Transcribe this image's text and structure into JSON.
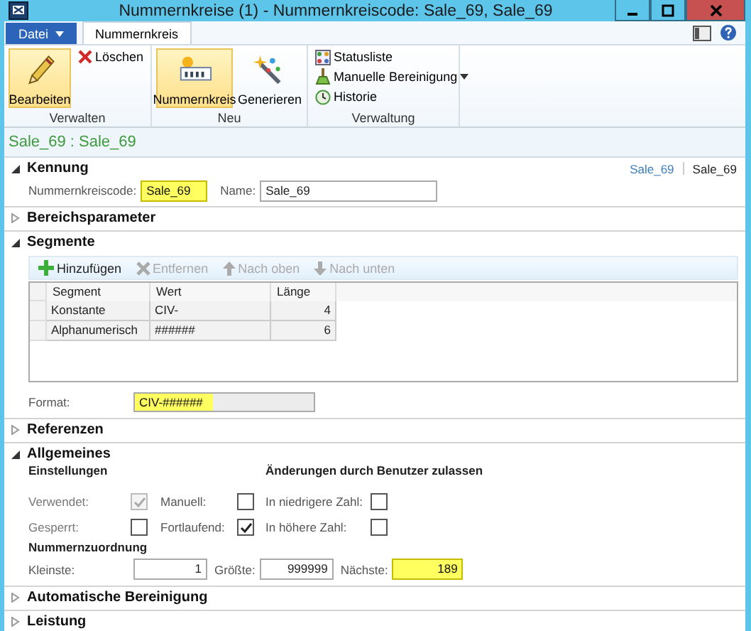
{
  "window": {
    "title": "Nummernkreise (1) - Nummernkreiscode: Sale_69, Sale_69"
  },
  "file_menu": {
    "label": "Datei"
  },
  "tabs": [
    {
      "label": "Nummernkreis",
      "selected": true
    }
  ],
  "ribbon": [
    {
      "label": "Verwalten",
      "buttons": [
        {
          "label": "Bearbeiten",
          "kind": "large",
          "active": true
        },
        {
          "label": "Löschen",
          "kind": "small",
          "active": false
        }
      ]
    },
    {
      "label": "Neu",
      "buttons": [
        {
          "label": "Nummernkreis",
          "kind": "large",
          "active": true
        },
        {
          "label": "Generieren",
          "kind": "large",
          "active": false
        }
      ]
    },
    {
      "label": "Verwaltung",
      "buttons": [
        {
          "label": "Statusliste",
          "kind": "small",
          "active": false
        },
        {
          "label": "Manuelle Bereinigung",
          "kind": "small",
          "active": false,
          "dropdown": true
        },
        {
          "label": "Historie",
          "kind": "small",
          "active": false
        }
      ]
    }
  ],
  "record_title": "Sale_69 : Sale_69",
  "breadcrumb": [
    {
      "label": "Sale_69",
      "kind": "link"
    },
    {
      "label": "Sale_69",
      "kind": "current"
    }
  ],
  "sections": [
    {
      "title": "Kennung",
      "kind": "identification",
      "expanded": true,
      "fields": [
        {
          "label": "Nummernkreiscode:",
          "value": "Sale_69",
          "highlighted": true
        },
        {
          "label": "Name:",
          "value": "Sale_69",
          "highlighted": false
        }
      ]
    },
    {
      "title": "Bereichsparameter",
      "expanded": false
    },
    {
      "title": "Segmente",
      "kind": "segments",
      "expanded": true,
      "toolbar": [
        {
          "label": "Hinzufügen",
          "disabled": false
        },
        {
          "label": "Entfernen",
          "disabled": true
        },
        {
          "label": "Nach oben",
          "disabled": true
        },
        {
          "label": "Nach unten",
          "disabled": true
        }
      ],
      "table": {
        "columns": [
          "Segment",
          "Wert",
          "Länge"
        ],
        "rows": [
          [
            "Konstante",
            "CIV-",
            "4"
          ],
          [
            "Alphanumerisch",
            "######",
            "6"
          ]
        ]
      },
      "format": {
        "label": "Format:",
        "value": "CIV-######",
        "highlighted": true
      }
    },
    {
      "title": "Referenzen",
      "expanded": false
    },
    {
      "title": "Allgemeines",
      "kind": "general",
      "expanded": true,
      "settings_heading": "Einstellungen",
      "changes_heading": "Änderungen durch Benutzer zulassen",
      "checkboxes": [
        [
          {
            "label": "Verwendet:",
            "checked": true,
            "disabled": true
          },
          {
            "label": "Manuell:",
            "checked": false,
            "disabled": false
          },
          {
            "label": "In niedrigere Zahl:",
            "checked": false,
            "disabled": false
          }
        ],
        [
          {
            "label": "Gesperrt:",
            "checked": false,
            "disabled": false
          },
          {
            "label": "Fortlaufend:",
            "checked": true,
            "disabled": false
          },
          {
            "label": "In höhere Zahl:",
            "checked": false,
            "disabled": false
          }
        ]
      ],
      "allocation_heading": "Nummernzuordnung",
      "allocation": [
        {
          "label": "Kleinste:",
          "value": "1",
          "highlighted": false
        },
        {
          "label": "Größte:",
          "value": "999999",
          "highlighted": false
        },
        {
          "label": "Nächste:",
          "value": "189",
          "highlighted": true
        }
      ]
    },
    {
      "title": "Automatische Bereinigung",
      "expanded": false
    },
    {
      "title": "Leistung",
      "expanded": false
    }
  ]
}
